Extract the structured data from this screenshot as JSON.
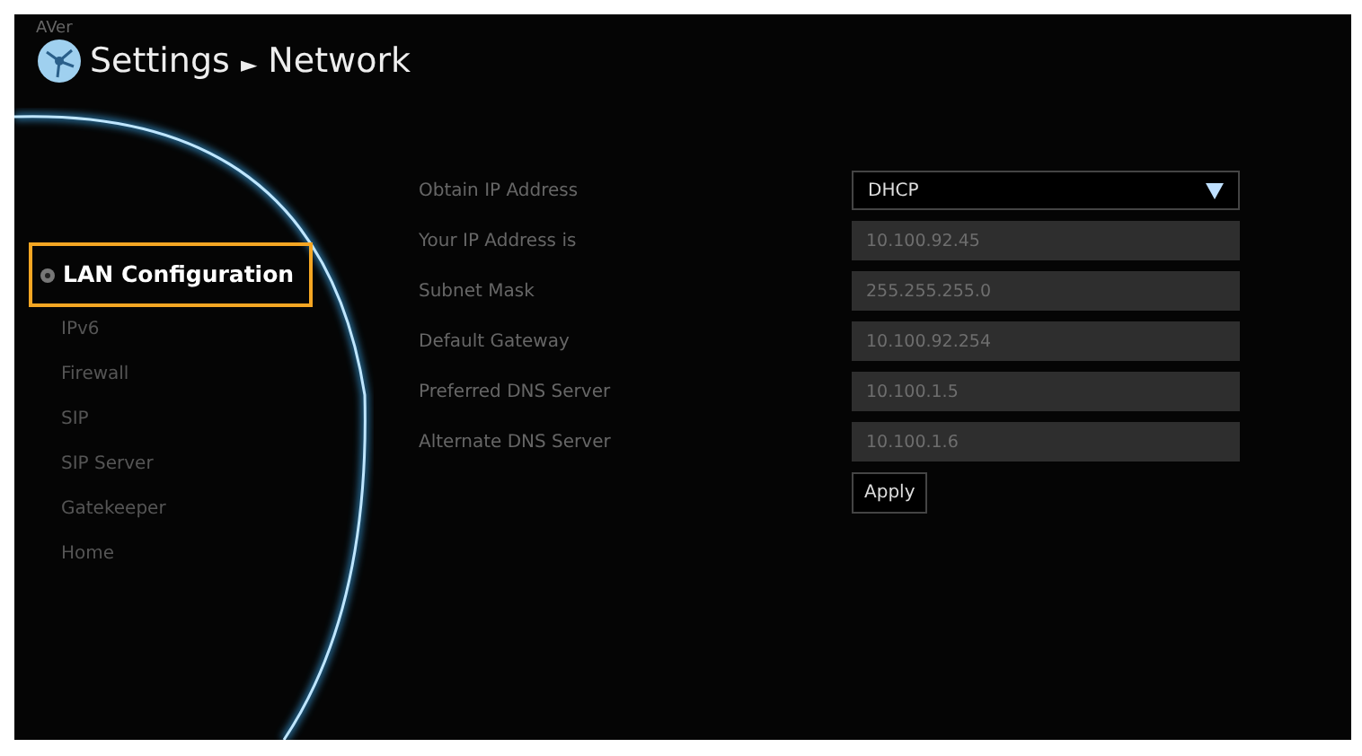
{
  "brand": "AVer",
  "title": {
    "section": "Settings",
    "separator": "►",
    "page": "Network"
  },
  "menu": [
    {
      "label": "LAN Configuration",
      "selected": true
    },
    {
      "label": "IPv6",
      "selected": false
    },
    {
      "label": "Firewall",
      "selected": false
    },
    {
      "label": "SIP",
      "selected": false
    },
    {
      "label": "SIP Server",
      "selected": false
    },
    {
      "label": "Gatekeeper",
      "selected": false
    },
    {
      "label": "Home",
      "selected": false
    }
  ],
  "fields": [
    {
      "label": "Obtain IP Address",
      "kind": "select",
      "value": "DHCP",
      "disabled": false
    },
    {
      "label": "Your IP Address is",
      "kind": "text",
      "value": "10.100.92.45",
      "disabled": true
    },
    {
      "label": "Subnet Mask",
      "kind": "text",
      "value": "255.255.255.0",
      "disabled": true
    },
    {
      "label": "Default Gateway",
      "kind": "text",
      "value": "10.100.92.254",
      "disabled": true
    },
    {
      "label": "Preferred DNS Server",
      "kind": "text",
      "value": "10.100.1.5",
      "disabled": true
    },
    {
      "label": "Alternate DNS Server",
      "kind": "text",
      "value": "10.100.1.6",
      "disabled": true
    }
  ],
  "apply_button": "Apply"
}
